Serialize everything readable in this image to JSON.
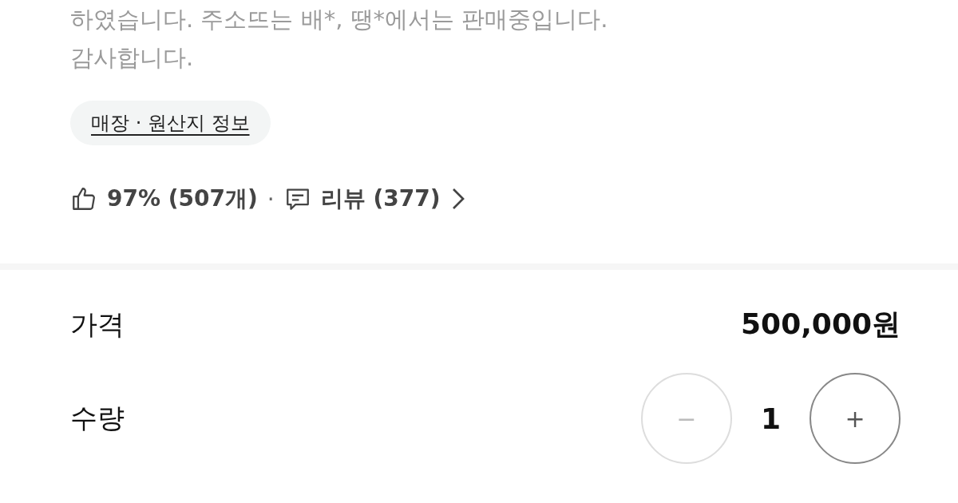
{
  "description": [
    "하였습니다. 주소뜨는 배*, 땡*에서는 판매중입니다.",
    "감사합니다."
  ],
  "store_info_link": "매장 · 원산지 정보",
  "rating": {
    "likes": "97% (507개)",
    "separator": "·",
    "reviews": "리뷰 (377)"
  },
  "price": {
    "label": "가격",
    "value": "500,000원"
  },
  "quantity": {
    "label": "수량",
    "value": "1",
    "buttons": [
      {
        "kind": "minus",
        "label": "−",
        "disabled": true
      },
      {
        "kind": "plus",
        "label": "+",
        "disabled": false
      }
    ]
  }
}
